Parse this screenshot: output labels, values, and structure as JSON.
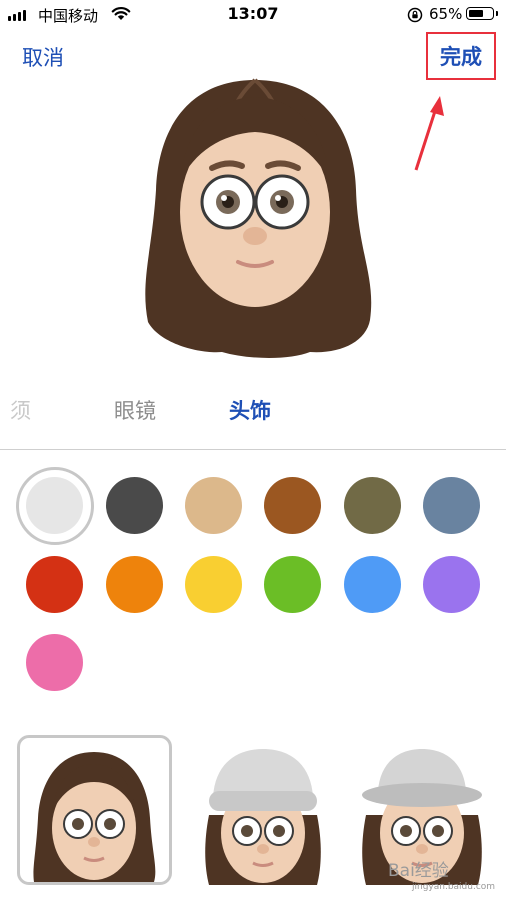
{
  "status_bar": {
    "carrier": "中国移动",
    "time": "13:07",
    "battery_percent": "65%",
    "battery_level": 0.65,
    "icons": [
      "signal-icon",
      "wifi-icon",
      "rotation-lock-icon",
      "battery-icon"
    ]
  },
  "nav": {
    "cancel_label": "取消",
    "done_label": "完成",
    "annotation_color": "#e8303c"
  },
  "tabs": [
    {
      "label": "须",
      "state": "faded"
    },
    {
      "label": "眼镜",
      "state": "inactive"
    },
    {
      "label": "头饰",
      "state": "active"
    }
  ],
  "colors": {
    "accent": "#1e4fb5"
  },
  "swatches": [
    {
      "color": "#e6e6e6",
      "selected": true
    },
    {
      "color": "#4a4a4a"
    },
    {
      "color": "#dcb88b"
    },
    {
      "color": "#9b5721"
    },
    {
      "color": "#716a46"
    },
    {
      "color": "#6983a0"
    },
    {
      "color": "#d43114"
    },
    {
      "color": "#ee830c"
    },
    {
      "color": "#f9cf31"
    },
    {
      "color": "#6bbe26"
    },
    {
      "color": "#4f9bf6"
    },
    {
      "color": "#9a73ee"
    },
    {
      "color": "#ed6da9"
    }
  ],
  "style_options": [
    {
      "name": "none",
      "selected": true
    },
    {
      "name": "beanie"
    },
    {
      "name": "bucket-hat"
    }
  ],
  "watermark": {
    "text": "Bai经验",
    "url": "jingyan.baidu.com"
  }
}
